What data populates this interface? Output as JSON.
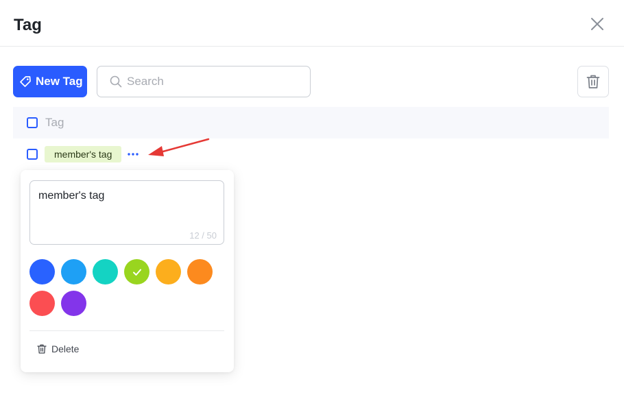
{
  "dialog": {
    "title": "Tag"
  },
  "toolbar": {
    "new_tag_label": "New Tag",
    "search_placeholder": "Search",
    "search_value": ""
  },
  "table": {
    "header_label": "Tag",
    "rows": [
      {
        "name": "member's tag",
        "color": "#e8f6cf"
      }
    ]
  },
  "editor": {
    "name_value": "member's tag",
    "char_count": "12 / 50",
    "colors": [
      "#2962ff",
      "#1ea0f5",
      "#14d3c3",
      "#99d51f",
      "#fcae1d",
      "#fc8a1e",
      "#fb4e52",
      "#8335ea"
    ],
    "selected_color_index": 3,
    "delete_label": "Delete"
  },
  "icons": {
    "close": "close-icon",
    "new_tag": "tag-icon",
    "search": "search-icon",
    "trash": "trash-icon",
    "more": "more-dots-icon",
    "check": "check-icon"
  },
  "accent_color": "#2a5cff",
  "annotation_color": "#e53935"
}
